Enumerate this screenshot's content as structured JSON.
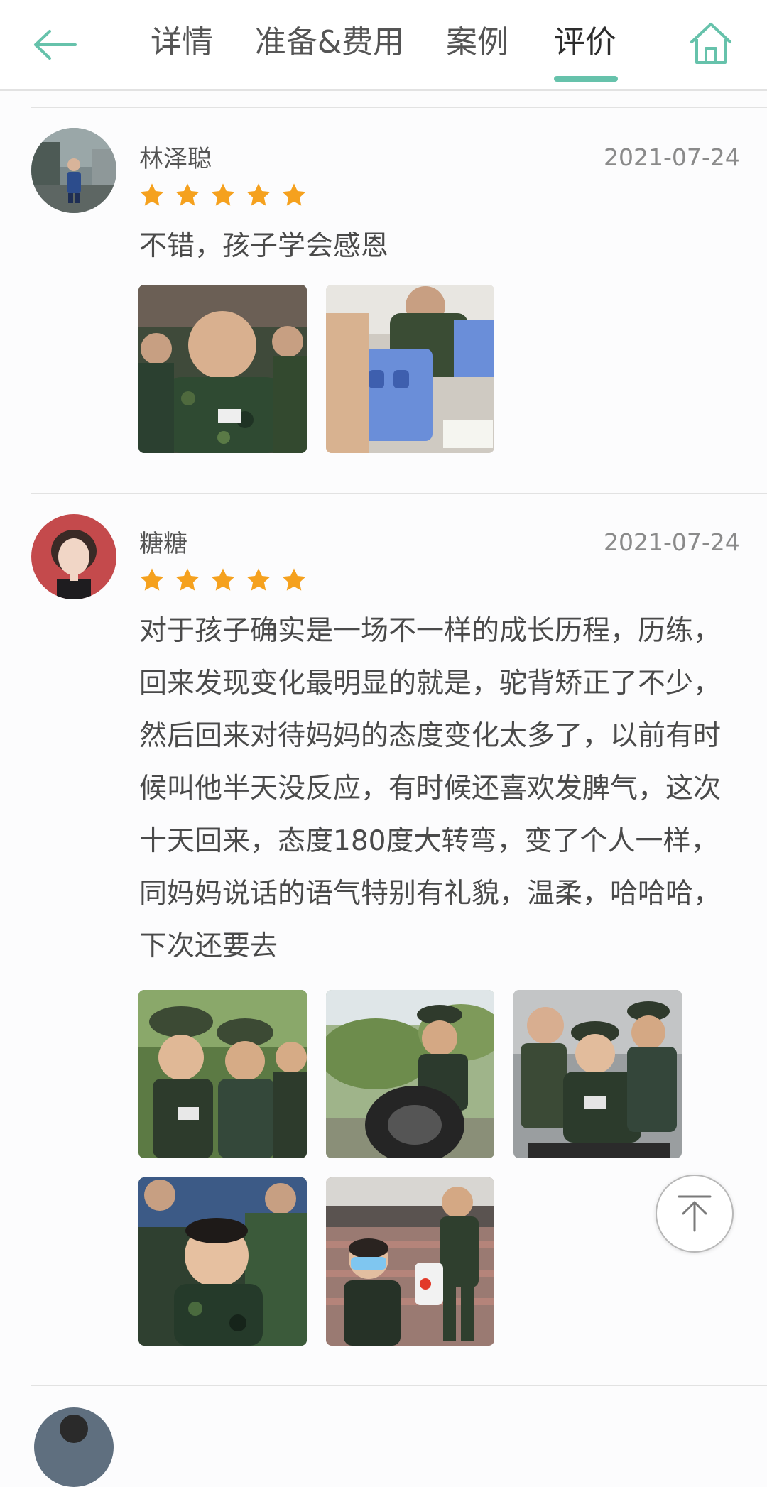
{
  "tabs": [
    {
      "label": "详情",
      "active": false
    },
    {
      "label": "准备&费用",
      "active": false
    },
    {
      "label": "案例",
      "active": false
    },
    {
      "label": "评价",
      "active": true
    }
  ],
  "icons": {
    "back": "arrow-left-icon",
    "home": "home-icon",
    "top": "arrow-up-icon",
    "star": "star-icon"
  },
  "colors": {
    "accent": "#66c2ab",
    "star": "#f5a11e"
  },
  "reviews": [
    {
      "name": "林泽聪",
      "date": "2021-07-24",
      "rating": 5,
      "comment": "不错，孩子学会感恩",
      "photo_count": 2
    },
    {
      "name": "糖糖",
      "date": "2021-07-24",
      "rating": 5,
      "comment": "对于孩子确实是一场不一样的成长历程，历练，回来发现变化最明显的就是，驼背矫正了不少，然后回来对待妈妈的态度变化太多了，以前有时候叫他半天没反应，有时候还喜欢发脾气，这次十天回来，态度180度大转弯，变了个人一样，同妈妈说话的语气特别有礼貌，温柔，哈哈哈，下次还要去",
      "photo_count": 5
    }
  ]
}
